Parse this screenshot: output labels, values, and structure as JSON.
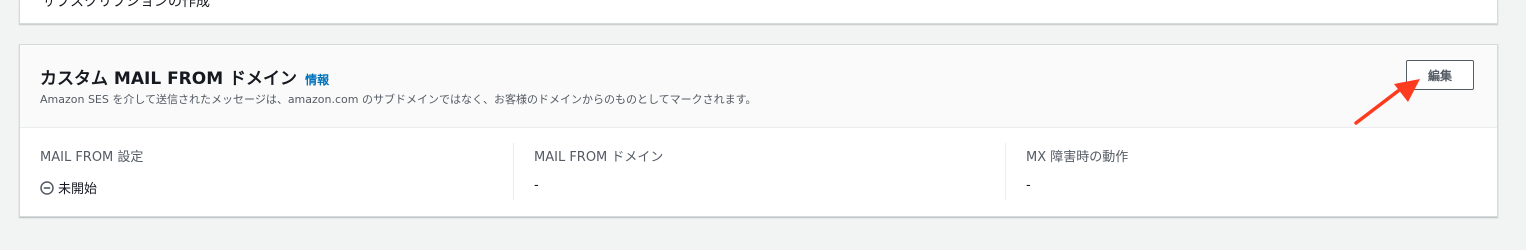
{
  "previous_section": {
    "truncated_text": "サブスクリプションの作成"
  },
  "section": {
    "title": "カスタム MAIL FROM ドメイン",
    "info_link": "情報",
    "description": "Amazon SES を介して送信されたメッセージは、amazon.com のサブドメインではなく、お客様のドメインからのものとしてマークされます。",
    "edit_button": "編集"
  },
  "fields": [
    {
      "label": "MAIL FROM 設定",
      "value": "未開始",
      "icon": "status-not-started-icon"
    },
    {
      "label": "MAIL FROM ドメイン",
      "value": "-"
    },
    {
      "label": "MX 障害時の動作",
      "value": "-"
    }
  ],
  "colors": {
    "background": "#f2f3f3",
    "card": "#ffffff",
    "link": "#0073bb",
    "annotation_arrow": "#ff3b1f"
  }
}
